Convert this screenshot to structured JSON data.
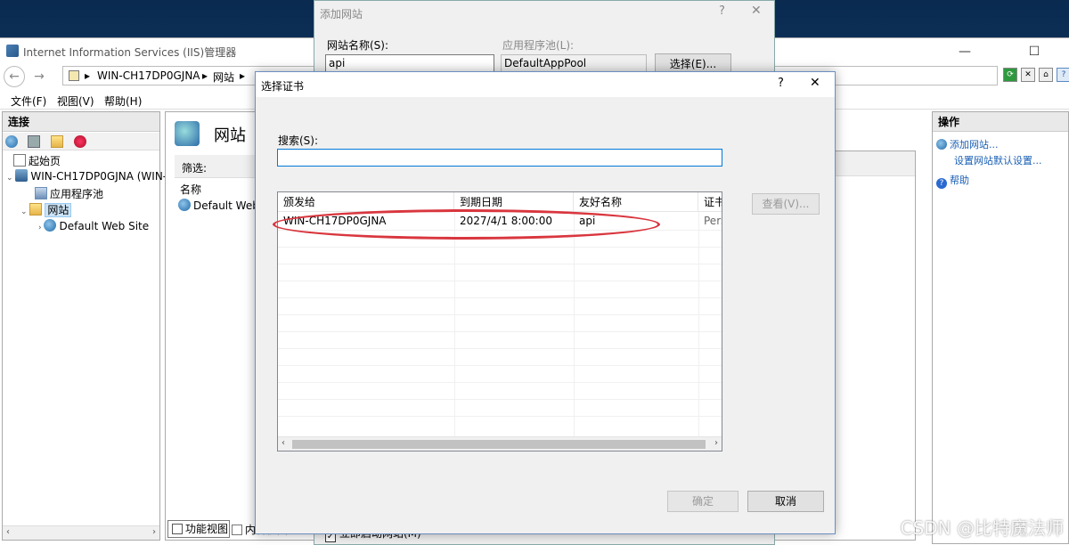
{
  "iis_window": {
    "title": "Internet Information Services (IIS)管理器",
    "breadcrumb": [
      "WIN-CH17DP0GJNA",
      "网站"
    ],
    "menu": [
      "文件(F)",
      "视图(V)",
      "帮助(H)"
    ],
    "connections": {
      "header": "连接",
      "tree": {
        "start_page": "起始页",
        "server": "WIN-CH17DP0GJNA (WIN-",
        "app_pools": "应用程序池",
        "sites": "网站",
        "default_site": "Default Web Site"
      }
    },
    "center": {
      "title": "网站",
      "filter_label": "筛选:",
      "col_name": "名称",
      "row_site": "Default Web S",
      "view_tabs": [
        "功能视图",
        "内容视图"
      ]
    },
    "actions": {
      "header": "操作",
      "items": [
        "添加网站...",
        "设置网站默认设置...",
        "帮助"
      ]
    }
  },
  "add_site_dialog": {
    "title": "添加网站",
    "site_name_label": "网站名称(S):",
    "site_name_value": "api",
    "app_pool_label": "应用程序池(L):",
    "app_pool_value": "DefaultAppPool",
    "select_button": "选择(E)...",
    "start_checkbox_label": "立即启动网站(M)",
    "start_checked": true
  },
  "cert_dialog": {
    "title": "选择证书",
    "help_glyph": "?",
    "close_glyph": "✕",
    "search_label": "搜索(S):",
    "search_value": "",
    "columns": [
      "颁发给",
      "到期日期",
      "友好名称",
      "证书"
    ],
    "rows": [
      [
        "WIN-CH17DP0GJNA",
        "2027/4/1 8:00:00",
        "api",
        "Pers"
      ]
    ],
    "view_button": "查看(V)...",
    "ok_button": "确定",
    "cancel_button": "取消"
  },
  "watermark": "CSDN @比特魔法师",
  "colors": {
    "highlight_oval": "#d9363e",
    "dialog_bg": "#f0f0f0"
  }
}
